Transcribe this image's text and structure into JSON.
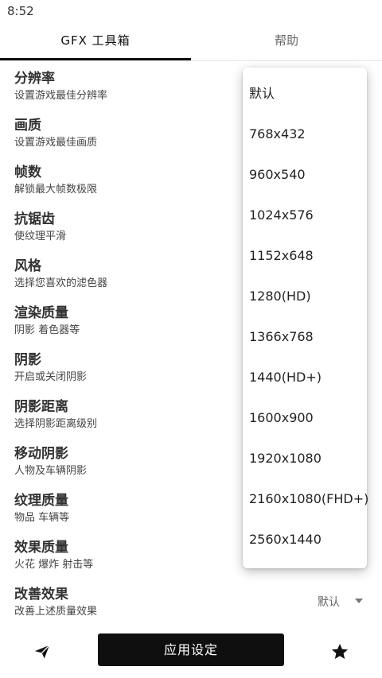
{
  "status_bar": {
    "time": "8:52"
  },
  "tabs": [
    {
      "label": "GFX 工具箱"
    },
    {
      "label": "帮助"
    }
  ],
  "settings": [
    {
      "title": "分辨率",
      "subtitle": "设置游戏最佳分辨率"
    },
    {
      "title": "画质",
      "subtitle": "设置游戏最佳画质"
    },
    {
      "title": "帧数",
      "subtitle": "解锁最大帧数极限"
    },
    {
      "title": "抗锯齿",
      "subtitle": "使纹理平滑"
    },
    {
      "title": "风格",
      "subtitle": "选择您喜欢的滤色器"
    },
    {
      "title": "渲染质量",
      "subtitle": "阴影 着色器等"
    },
    {
      "title": "阴影",
      "subtitle": "开启或关闭阴影"
    },
    {
      "title": "阴影距离",
      "subtitle": "选择阴影距离级别"
    },
    {
      "title": "移动阴影",
      "subtitle": "人物及车辆阴影"
    },
    {
      "title": "纹理质量",
      "subtitle": "物品 车辆等"
    },
    {
      "title": "效果质量",
      "subtitle": "火花 爆炸 射击等"
    },
    {
      "title": "改善效果",
      "subtitle": "改善上述质量效果",
      "value": "默认"
    }
  ],
  "resolution_dropdown": {
    "options": [
      "默认",
      "768x432",
      "960x540",
      "1024x576",
      "1152x648",
      "1280(HD)",
      "1366x768",
      "1440(HD+)",
      "1600x900",
      "1920x1080",
      "2160x1080(FHD+)",
      "2560x1440"
    ]
  },
  "bottom_bar": {
    "apply_label": "应用设定",
    "left_icon": "paper-plane-icon",
    "right_icon": "star-icon"
  },
  "colors": {
    "accent": "#111111",
    "apply_button": "#0f0f0f"
  }
}
